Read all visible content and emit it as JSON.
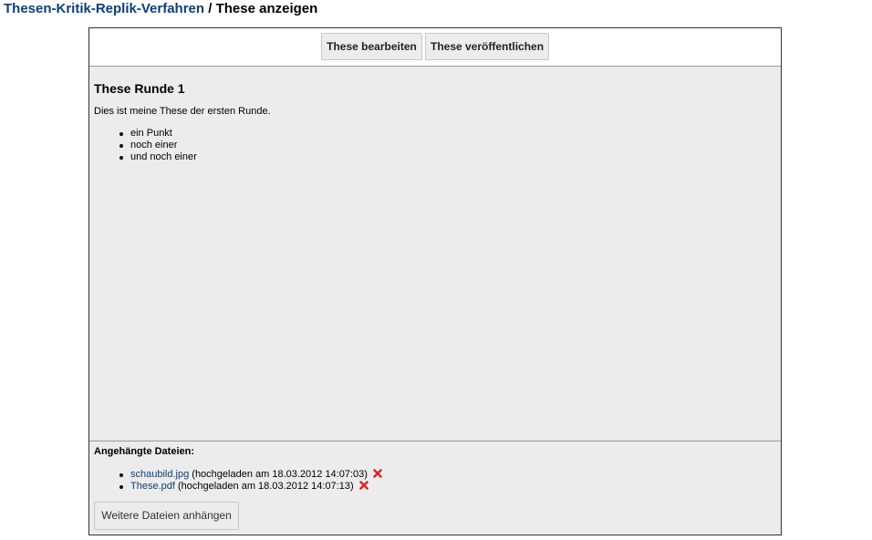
{
  "breadcrumb": {
    "module_link": "Thesen-Kritik-Replik-Verfahren",
    "separator": " / ",
    "page_title": "These anzeigen"
  },
  "toolbar": {
    "edit_label": "These bearbeiten",
    "publish_label": "These veröffentlichen"
  },
  "thesis": {
    "heading": "These Runde 1",
    "intro": "Dies ist meine These der ersten Runde.",
    "points": [
      "ein Punkt",
      "noch einer",
      "und noch einer"
    ]
  },
  "attachments": {
    "title": "Angehängte Dateien:",
    "files": [
      {
        "name": "schaubild.jpg",
        "meta": " (hochgeladen am 18.03.2012 14:07:03)",
        "delete_icon": "delete-x-icon"
      },
      {
        "name": "These.pdf",
        "meta": " (hochgeladen am 18.03.2012 14:07:13)",
        "delete_icon": "delete-x-icon"
      }
    ],
    "add_button_label": "Weitere Dateien anhängen"
  },
  "colors": {
    "link": "#0f3e75",
    "panel_background": "#ececec",
    "delete_icon": "#d9272b"
  }
}
